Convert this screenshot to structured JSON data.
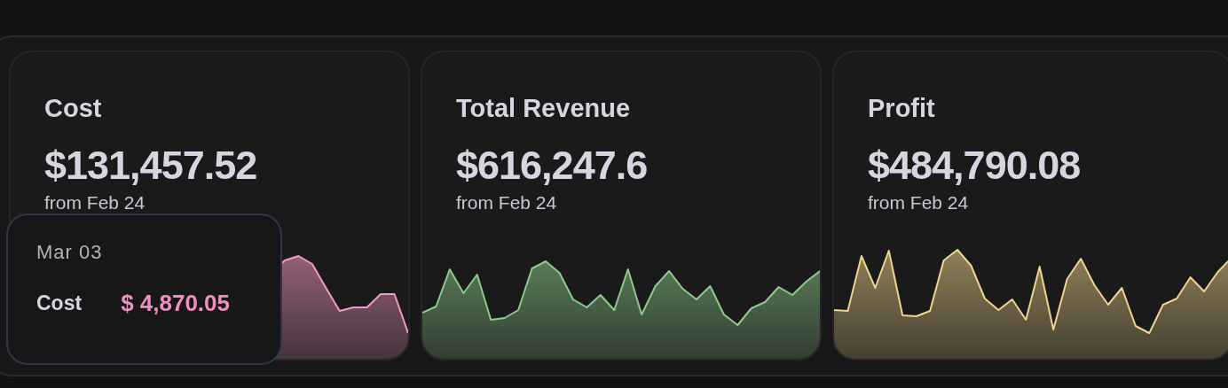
{
  "cards": [
    {
      "title": "Cost",
      "value": "$131,457.52",
      "subtitle": "from Feb 24",
      "color": "#f49ac7"
    },
    {
      "title": "Total Revenue",
      "value": "$616,247.6",
      "subtitle": "from Feb 24",
      "color": "#8fcb8c"
    },
    {
      "title": "Profit",
      "value": "$484,790.08",
      "subtitle": "from Feb 24",
      "color": "#f0d58c"
    }
  ],
  "tooltip": {
    "date": "Mar 03",
    "label": "Cost",
    "value": "$ 4,870.05"
  }
}
